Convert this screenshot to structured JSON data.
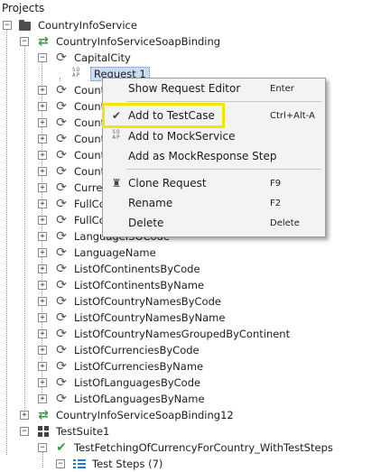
{
  "panel": {
    "title": "Projects"
  },
  "tree": {
    "project": "CountryInfoService",
    "binding1": "CountryInfoServiceSoapBinding",
    "capital_city": "CapitalCity",
    "request1": "Request 1",
    "hidden_ops": [
      "Countr",
      "Countr",
      "Countr",
      "Countr",
      "Countr",
      "Countr",
      "Curren",
      "FullCo",
      "FullCo"
    ],
    "ops": [
      "LanguageISOCode",
      "LanguageName",
      "ListOfContinentsByCode",
      "ListOfContinentsByName",
      "ListOfCountryNamesByCode",
      "ListOfCountryNamesByName",
      "ListOfCountryNamesGroupedByContinent",
      "ListOfCurrenciesByCode",
      "ListOfCurrenciesByName",
      "ListOfLanguagesByCode",
      "ListOfLanguagesByName"
    ],
    "binding2": "CountryInfoServiceSoapBinding12",
    "testsuite": "TestSuite1",
    "testcase": "TestFetchingOfCurrencyForCountry_WithTestSteps",
    "teststeps": "Test Steps (7)"
  },
  "menu": {
    "items": [
      {
        "label": "Show Request Editor",
        "shortcut": "Enter"
      },
      {
        "label": "Add to TestCase",
        "shortcut": "Ctrl+Alt-A"
      },
      {
        "label": "Add to MockService",
        "shortcut": ""
      },
      {
        "label": "Add as MockResponse Step",
        "shortcut": ""
      },
      {
        "label": "Clone Request",
        "shortcut": "F9"
      },
      {
        "label": "Rename",
        "shortcut": "F2"
      },
      {
        "label": "Delete",
        "shortcut": "Delete"
      }
    ],
    "highlight_color": "#f5e400"
  }
}
